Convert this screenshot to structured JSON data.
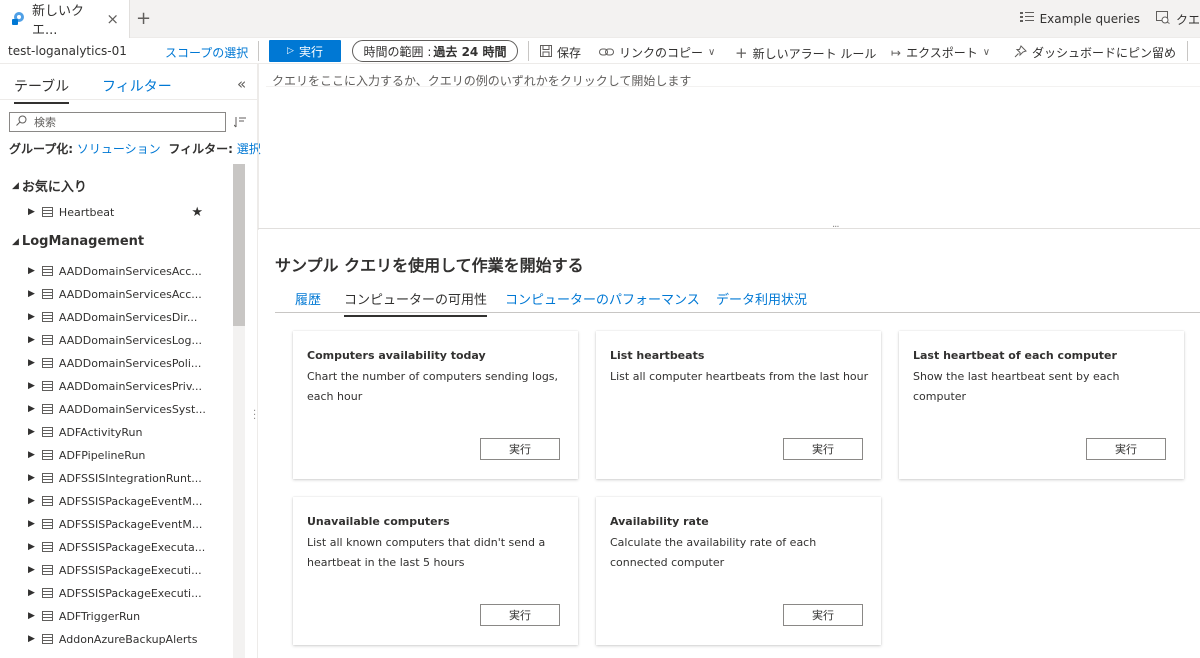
{
  "tabbar": {
    "doc_tab_label": "新しいクエ...",
    "close_glyph": "×",
    "add_glyph": "+",
    "example_queries": "Example queries",
    "query_explorer": "クエ"
  },
  "toolbar": {
    "workspace": "test-loganalytics-01",
    "scope_link": "スコープの選択",
    "run_label": "実行",
    "time_range_prefix": "時間の範囲 :",
    "time_range_value": "過去 24 時間",
    "save": "保存",
    "copy_link": "リンクのコピー",
    "new_alert": "新しいアラート ルール",
    "export": "エクスポート",
    "pin": "ダッシュボードにピン留め"
  },
  "sidebar": {
    "tab_tables": "テーブル",
    "tab_filter": "フィルター",
    "collapse_glyph": "«",
    "search_placeholder": "検索",
    "group_label": "グループ化:",
    "group_value": "ソリューション",
    "filter_label": "フィルター:",
    "filter_value": "選択",
    "favorites": "お気に入り",
    "favorite_items": [
      "Heartbeat"
    ],
    "log_management": "LogManagement",
    "items": [
      "AADDomainServicesAcc...",
      "AADDomainServicesAcc...",
      "AADDomainServicesDir...",
      "AADDomainServicesLog...",
      "AADDomainServicesPoli...",
      "AADDomainServicesPriv...",
      "AADDomainServicesSyst...",
      "ADFActivityRun",
      "ADFPipelineRun",
      "ADFSSISIntegrationRunt...",
      "ADFSSISPackageEventM...",
      "ADFSSISPackageEventM...",
      "ADFSSISPackageExecuta...",
      "ADFSSISPackageExecuti...",
      "ADFSSISPackageExecuti...",
      "ADFTriggerRun",
      "AddonAzureBackupAlerts"
    ]
  },
  "editor": {
    "placeholder": "クエリをここに入力するか、クエリの例のいずれかをクリックして開始します",
    "resize_glyph": "···"
  },
  "samples": {
    "title": "サンプル クエリを使用して作業を開始する",
    "tabs": [
      "履歴",
      "コンピューターの可用性",
      "コンピューターのパフォーマンス",
      "データ利用状況"
    ],
    "active_tab": 1,
    "run_label": "実行",
    "cards": [
      {
        "title": "Computers availability today",
        "desc": "Chart the number of computers sending logs, each hour"
      },
      {
        "title": "List heartbeats",
        "desc": "List all computer heartbeats from the last hour"
      },
      {
        "title": "Last heartbeat of each computer",
        "desc": "Show the last heartbeat sent by each computer"
      },
      {
        "title": "Unavailable computers",
        "desc": "List all known computers that didn't send a heartbeat in the last 5 hours"
      },
      {
        "title": "Availability rate",
        "desc": "Calculate the availability rate of each connected computer"
      }
    ]
  },
  "colors": {
    "accent": "#0078d4",
    "text": "#323130",
    "muted": "#605e5c"
  },
  "icons": {
    "run": "play-icon",
    "save": "save-icon",
    "copy_link": "link-icon",
    "new_alert": "plus-icon",
    "export": "export-icon",
    "pin": "pin-icon",
    "search": "search-icon",
    "star": "star-icon"
  }
}
